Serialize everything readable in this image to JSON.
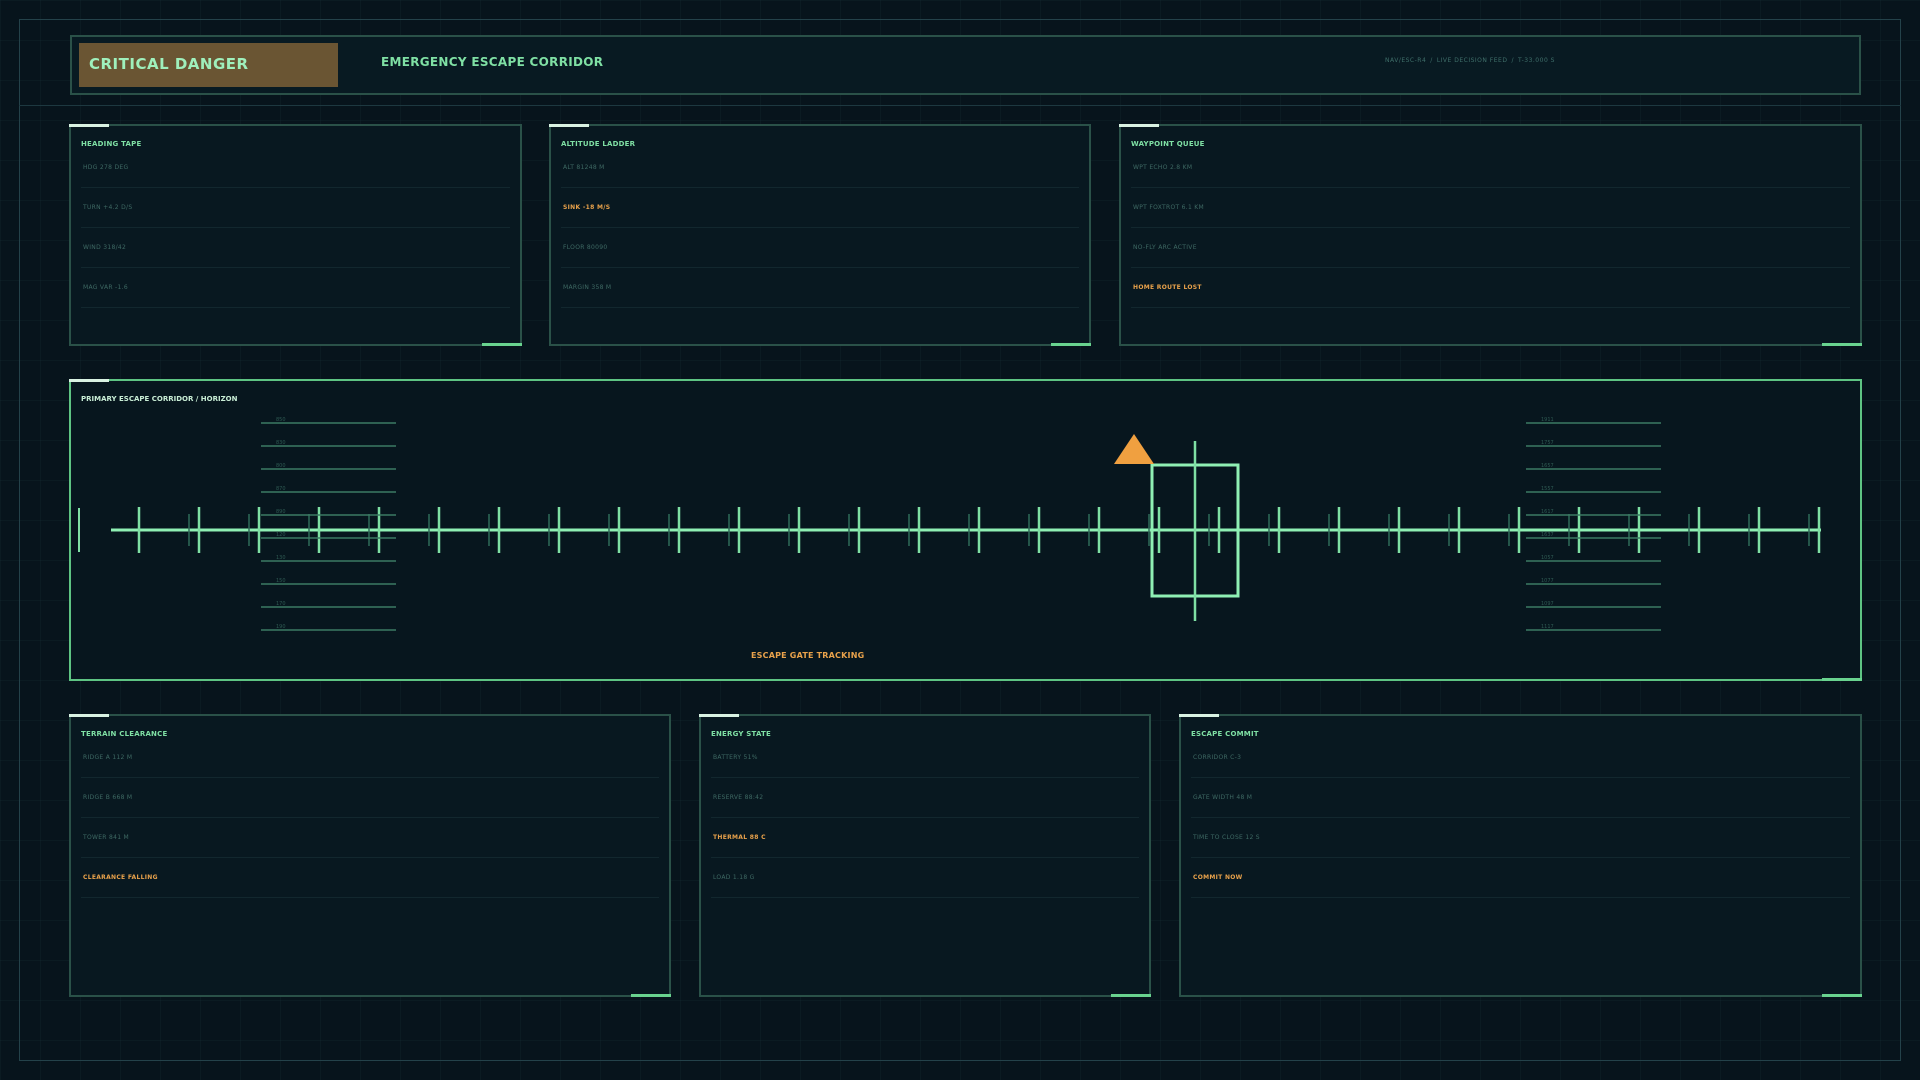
{
  "header": {
    "status_badge": "CRITICAL DANGER",
    "title": "EMERGENCY ESCAPE CORRIDOR",
    "feed": [
      "NAV/ESC-R4",
      "LIVE DECISION FEED",
      "T-33.000 S"
    ]
  },
  "panels_top": [
    {
      "title": "HEADING TAPE",
      "rows": [
        {
          "text": "HDG 278 DEG",
          "warn": false
        },
        {
          "text": "TURN +4.2 D/S",
          "warn": false
        },
        {
          "text": "WIND 318/42",
          "warn": false
        },
        {
          "text": "MAG VAR -1.6",
          "warn": false
        }
      ]
    },
    {
      "title": "ALTITUDE LADDER",
      "rows": [
        {
          "text": "ALT 81248 M",
          "warn": false
        },
        {
          "text": "SINK -18 M/S",
          "warn": true
        },
        {
          "text": "FLOOR 80090",
          "warn": false
        },
        {
          "text": "MARGIN 358 M",
          "warn": false
        }
      ]
    },
    {
      "title": "WAYPOINT QUEUE",
      "rows": [
        {
          "text": "WPT ECHO 2.8 KM",
          "warn": false
        },
        {
          "text": "WPT FOXTROT 6.1 KM",
          "warn": false
        },
        {
          "text": "NO-FLY ARC ACTIVE",
          "warn": false
        },
        {
          "text": "HOME ROUTE LOST",
          "warn": true
        }
      ]
    }
  ],
  "main": {
    "title": "PRIMARY ESCAPE CORRIDOR / HORIZON",
    "gate_label": "ESCAPE GATE TRACKING",
    "ladder_left": [
      "850",
      "830",
      "800",
      "870",
      "890",
      "120",
      "130",
      "150",
      "170",
      "190"
    ],
    "ladder_right": [
      "1911",
      "1757",
      "1657",
      "1557",
      "1617",
      "1637",
      "1057",
      "1077",
      "1097",
      "1117"
    ]
  },
  "panels_bottom": [
    {
      "title": "TERRAIN CLEARANCE",
      "rows": [
        {
          "text": "RIDGE A 112 M",
          "warn": false
        },
        {
          "text": "RIDGE B 668 M",
          "warn": false
        },
        {
          "text": "TOWER 841 M",
          "warn": false
        },
        {
          "text": "CLEARANCE FALLING",
          "warn": true
        }
      ]
    },
    {
      "title": "ENERGY STATE",
      "rows": [
        {
          "text": "BATTERY 51%",
          "warn": false
        },
        {
          "text": "RESERVE 88:42",
          "warn": false
        },
        {
          "text": "THERMAL 88 C",
          "warn": true
        },
        {
          "text": "LOAD 1.18 G",
          "warn": false
        }
      ]
    },
    {
      "title": "ESCAPE COMMIT",
      "rows": [
        {
          "text": "CORRIDOR C-3",
          "warn": false
        },
        {
          "text": "GATE WIDTH 48 M",
          "warn": false
        },
        {
          "text": "TIME TO CLOSE 12 S",
          "warn": false
        },
        {
          "text": "COMMIT NOW",
          "warn": true
        }
      ]
    }
  ],
  "colors": {
    "accent": "#7fe0a4",
    "warning": "#f0a040",
    "danger_badge": "#6a5533",
    "border": "#2a5148"
  },
  "icons": {
    "waypoint_marker": "warning-triangle-icon",
    "gate": "target-gate-icon"
  }
}
